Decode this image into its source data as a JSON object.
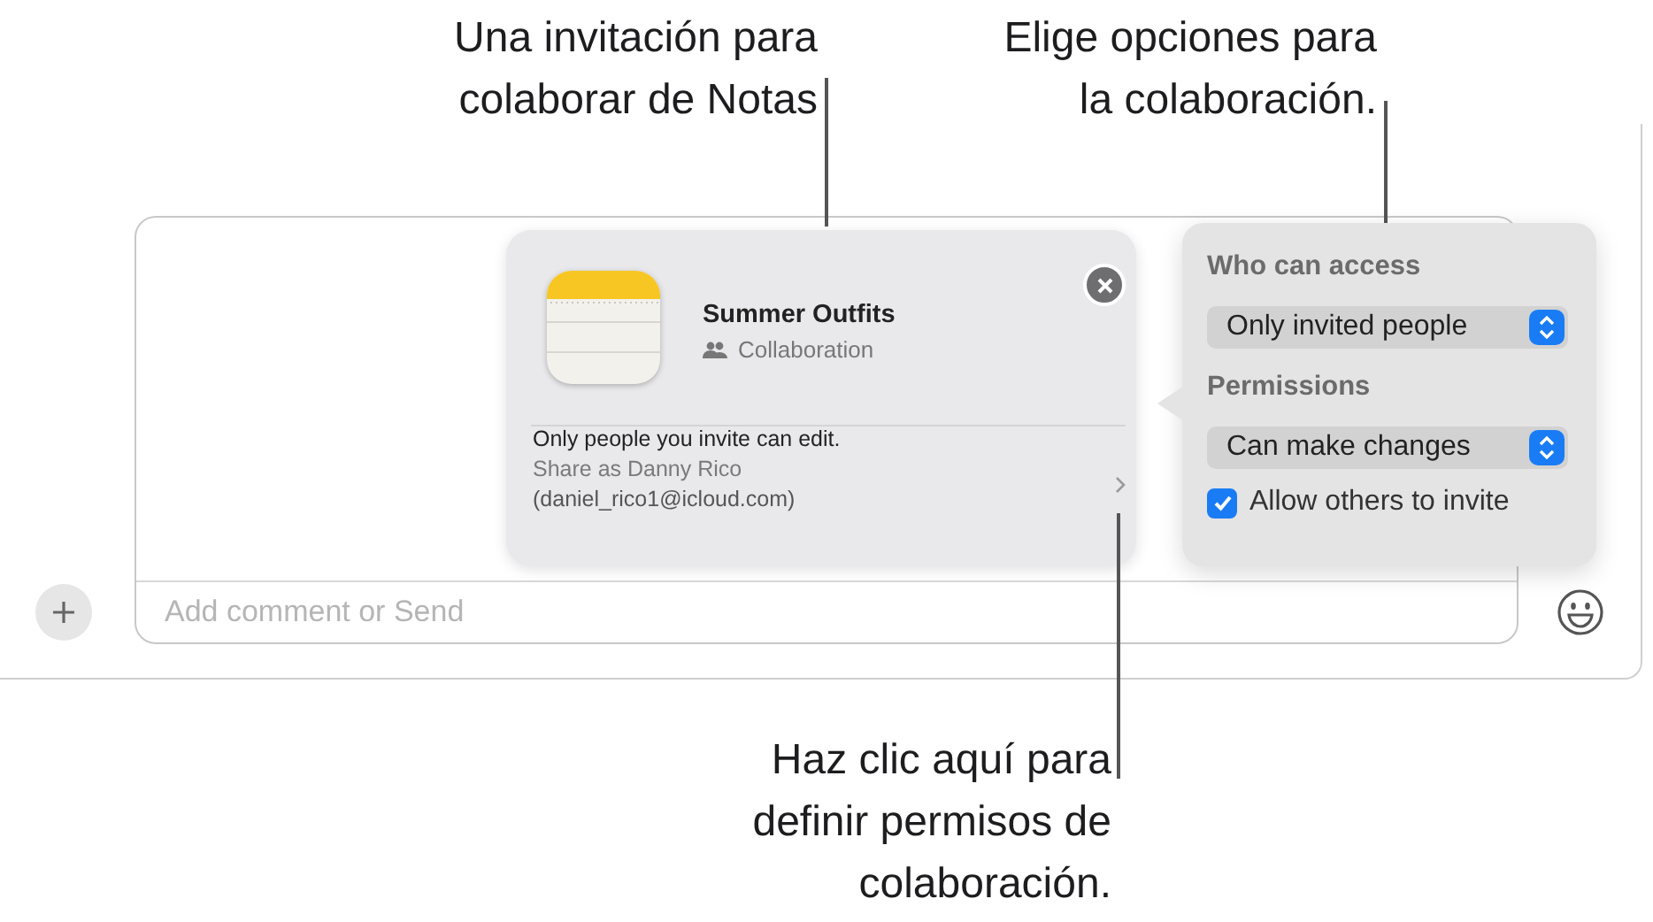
{
  "callouts": [
    {
      "text": "Una invitación para\ncolaborar de Notas",
      "kind": "top-left"
    },
    {
      "text": "Elige opciones para\nla colaboración.",
      "kind": "top-right"
    },
    {
      "text": "Haz clic aquí para\ndefinir permisos de\ncolaboración.",
      "kind": "bottom"
    }
  ],
  "invitation": {
    "title": "Summer Outfits",
    "subtitle": "Collaboration",
    "description": "Only people you invite can edit.",
    "share_as": "Share as Danny Rico",
    "email": "(daniel_rico1@icloud.com)"
  },
  "options": {
    "access_label": "Who can access",
    "access_value": "Only invited people",
    "permissions_label": "Permissions",
    "permissions_value": "Can make changes",
    "allow_invite": {
      "label": "Allow others to invite",
      "checked": true
    }
  },
  "compose": {
    "placeholder": "Add comment or Send"
  }
}
